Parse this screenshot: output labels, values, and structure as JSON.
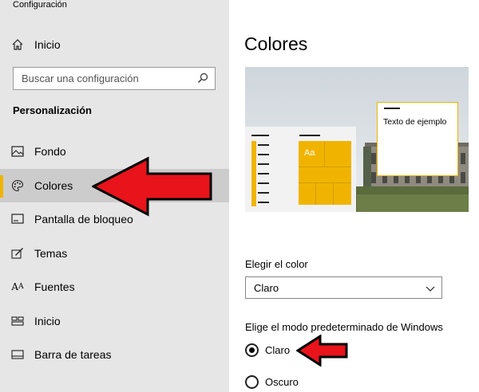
{
  "app": {
    "title": "Configuración"
  },
  "sidebar": {
    "home_label": "Inicio",
    "search_placeholder": "Buscar una configuración",
    "section_title": "Personalización",
    "items": [
      {
        "label": "Fondo",
        "icon": "image-icon"
      },
      {
        "label": "Colores",
        "icon": "palette-icon",
        "selected": true
      },
      {
        "label": "Pantalla de bloqueo",
        "icon": "lock-screen-icon"
      },
      {
        "label": "Temas",
        "icon": "brush-icon"
      },
      {
        "label": "Fuentes",
        "icon": "font-icon"
      },
      {
        "label": "Inicio",
        "icon": "start-icon"
      },
      {
        "label": "Barra de tareas",
        "icon": "taskbar-icon"
      }
    ]
  },
  "main": {
    "title": "Colores",
    "preview": {
      "sample_text": "Texto de ejemplo",
      "tile_label": "Aa"
    },
    "choose_color_label": "Elegir el color",
    "choose_color_value": "Claro",
    "windows_mode_label": "Elige el modo predeterminado de Windows",
    "windows_mode_options": [
      {
        "label": "Claro",
        "checked": true
      },
      {
        "label": "Oscuro",
        "checked": false
      }
    ]
  },
  "colors": {
    "accent": "#f0b400",
    "arrow": "#e8131b"
  }
}
